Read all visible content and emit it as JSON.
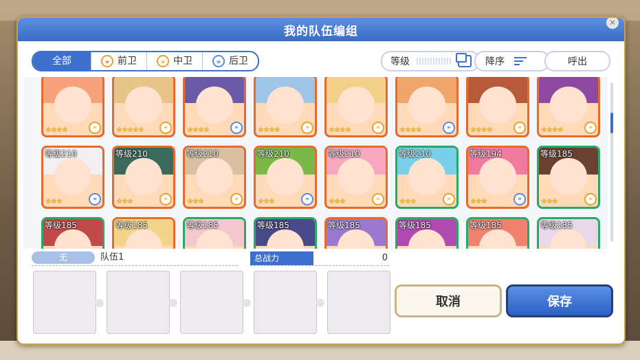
{
  "dialog": {
    "title": "我的队伍编组"
  },
  "tabs": [
    {
      "label": "全部",
      "active": true
    },
    {
      "label": "前卫",
      "icon": "front-role-icon"
    },
    {
      "label": "中卫",
      "icon": "middle-role-icon"
    },
    {
      "label": "后卫",
      "icon": "back-role-icon"
    }
  ],
  "sort": {
    "label": "等级",
    "order_label": "降序",
    "call_label": "呼出"
  },
  "characters": [
    {
      "level": "",
      "stars": "★★★★",
      "color": "orange"
    },
    {
      "level": "",
      "stars": "★★★★★",
      "color": "orange"
    },
    {
      "level": "",
      "stars": "★★★★",
      "color": "orange"
    },
    {
      "level": "",
      "stars": "★★★★",
      "color": "orange"
    },
    {
      "level": "",
      "stars": "★★★★",
      "color": "orange"
    },
    {
      "level": "",
      "stars": "★★★★",
      "color": "orange"
    },
    {
      "level": "",
      "stars": "★★★★",
      "color": "orange"
    },
    {
      "level": "",
      "stars": "★★★★",
      "color": "orange"
    },
    {
      "level": "等级210",
      "stars": "★★★",
      "color": "orange"
    },
    {
      "level": "等级210",
      "stars": "★★★",
      "color": "orange"
    },
    {
      "level": "等级210",
      "stars": "★★★",
      "color": "orange"
    },
    {
      "level": "等级210",
      "stars": "★★★",
      "color": "orange"
    },
    {
      "level": "等级210",
      "stars": "★★★",
      "color": "orange"
    },
    {
      "level": "等级210",
      "stars": "★★★",
      "color": "green"
    },
    {
      "level": "等级194",
      "stars": "★★★",
      "color": "orange"
    },
    {
      "level": "等级185",
      "stars": "★★★",
      "color": "green"
    },
    {
      "level": "等级185",
      "stars": "",
      "color": "green"
    },
    {
      "level": "等级185",
      "stars": "",
      "color": "orange"
    },
    {
      "level": "等级185",
      "stars": "",
      "color": "green"
    },
    {
      "level": "等级185",
      "stars": "",
      "color": "green"
    },
    {
      "level": "等级185",
      "stars": "",
      "color": "orange"
    },
    {
      "level": "等级185",
      "stars": "",
      "color": "green"
    },
    {
      "level": "等级185",
      "stars": "",
      "color": "green"
    },
    {
      "level": "等级185",
      "stars": "",
      "color": "green"
    }
  ],
  "team": {
    "badge": "无",
    "name": "队伍1",
    "power_label": "总战力",
    "power_value": "0"
  },
  "buttons": {
    "cancel": "取消",
    "save": "保存"
  }
}
